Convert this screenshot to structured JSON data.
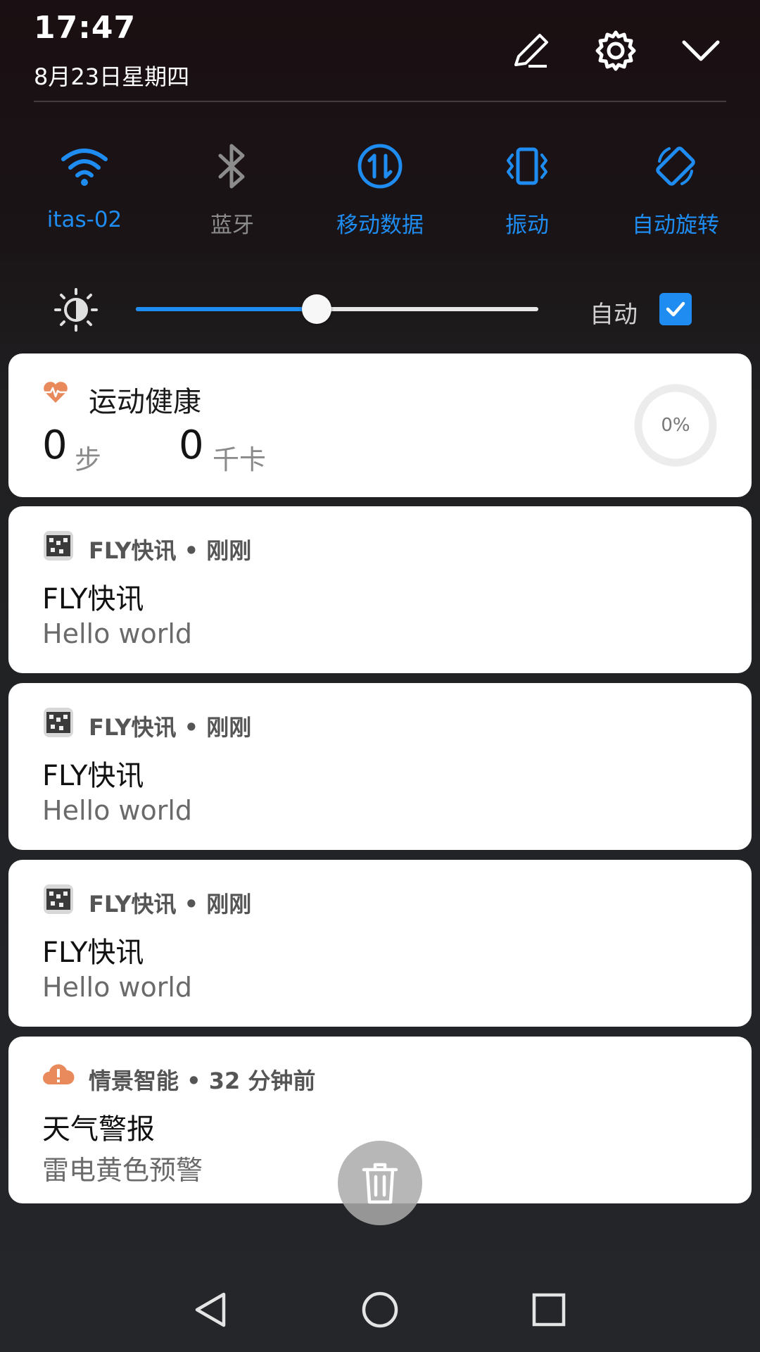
{
  "status": {
    "time": "17:47",
    "date": "8月23日星期四"
  },
  "header_icons": [
    "edit-icon",
    "settings-icon",
    "collapse-icon"
  ],
  "quick_toggles": [
    {
      "label": "itas-02",
      "icon": "wifi-icon",
      "state": "on"
    },
    {
      "label": "蓝牙",
      "icon": "bluetooth-icon",
      "state": "off"
    },
    {
      "label": "移动数据",
      "icon": "mobile-data-icon",
      "state": "on"
    },
    {
      "label": "振动",
      "icon": "vibrate-icon",
      "state": "on"
    },
    {
      "label": "自动旋转",
      "icon": "auto-rotate-icon",
      "state": "on"
    }
  ],
  "brightness": {
    "level": 0.45,
    "auto_label": "自动",
    "auto_checked": true
  },
  "health": {
    "title": "运动健康",
    "steps_value": "0",
    "steps_unit": "步",
    "calories_value": "0",
    "calories_unit": "千卡",
    "progress_label": "0%"
  },
  "notifications": [
    {
      "app": "FLY快讯",
      "time": "刚刚",
      "title": "FLY快讯",
      "body": "Hello world"
    },
    {
      "app": "FLY快讯",
      "time": "刚刚",
      "title": "FLY快讯",
      "body": "Hello world"
    },
    {
      "app": "FLY快讯",
      "time": "刚刚",
      "title": "FLY快讯",
      "body": "Hello world"
    },
    {
      "app": "情景智能",
      "time": "32 分钟前",
      "title": "天气警报",
      "body": "雷电黄色预警"
    }
  ],
  "colors": {
    "accent": "#1e8cf0",
    "toggle_off": "#8c8c8c",
    "health_icon": "#e88a5c"
  }
}
